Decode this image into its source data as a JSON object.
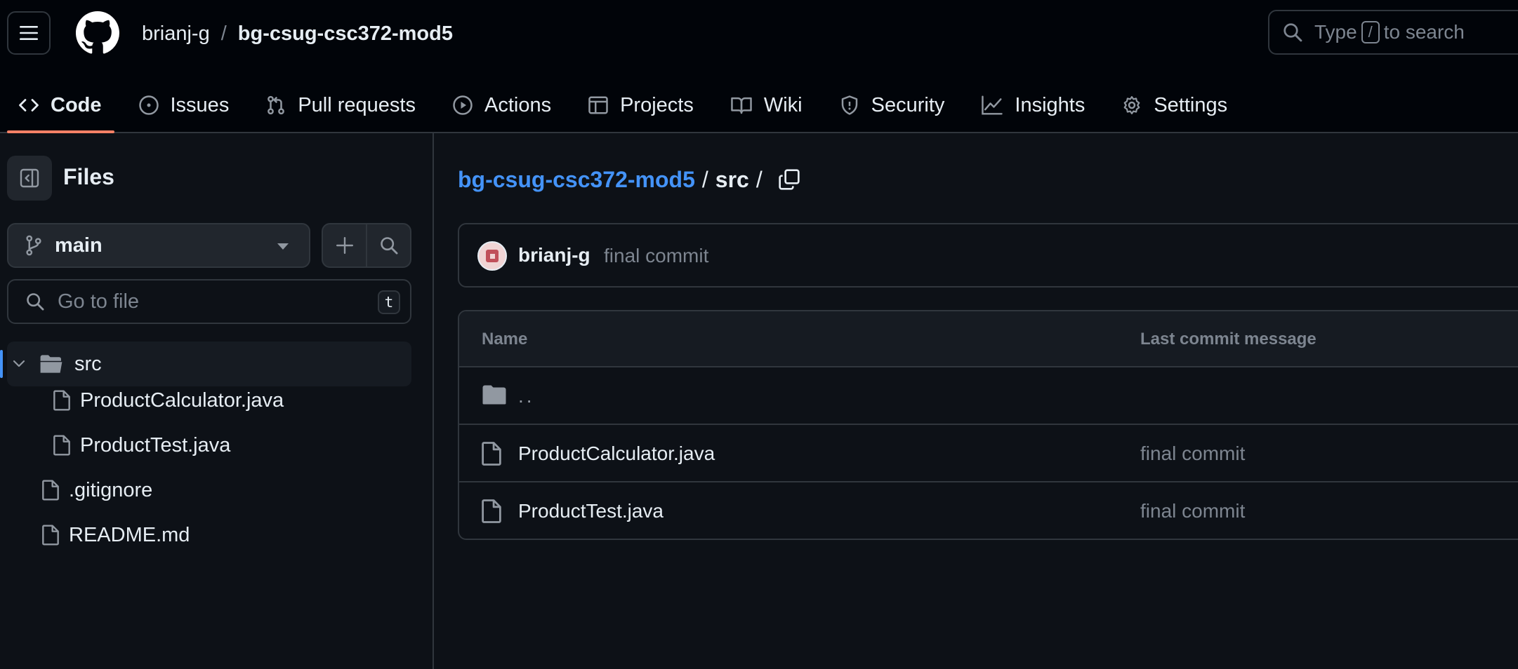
{
  "header": {
    "owner": "brianj-g",
    "separator": "/",
    "repo": "bg-csug-csc372-mod5",
    "search": {
      "prefix": "Type",
      "key": "/",
      "suffix": "to search"
    }
  },
  "nav": {
    "tabs": [
      {
        "label": "Code",
        "icon": "code-icon",
        "active": true
      },
      {
        "label": "Issues",
        "icon": "issue-opened-icon"
      },
      {
        "label": "Pull requests",
        "icon": "git-pull-request-icon"
      },
      {
        "label": "Actions",
        "icon": "play-icon"
      },
      {
        "label": "Projects",
        "icon": "table-icon"
      },
      {
        "label": "Wiki",
        "icon": "book-icon"
      },
      {
        "label": "Security",
        "icon": "shield-icon"
      },
      {
        "label": "Insights",
        "icon": "graph-icon"
      },
      {
        "label": "Settings",
        "icon": "gear-icon"
      }
    ],
    "accent": "#f78166"
  },
  "sidebar": {
    "title": "Files",
    "branch": "main",
    "goto_placeholder": "Go to file",
    "goto_shortcut": "t",
    "tree": [
      {
        "name": "src",
        "type": "folder",
        "expanded": true,
        "selected": true
      },
      {
        "name": "ProductCalculator.java",
        "type": "file",
        "depth": 1
      },
      {
        "name": "ProductTest.java",
        "type": "file",
        "depth": 1
      },
      {
        "name": ".gitignore",
        "type": "file",
        "depth": 0
      },
      {
        "name": "README.md",
        "type": "file",
        "depth": 0
      }
    ]
  },
  "main": {
    "breadcrumb": {
      "repo": "bg-csug-csc372-mod5",
      "sep1": "/",
      "folder": "src",
      "sep2": "/"
    },
    "commit": {
      "author": "brianj-g",
      "message": "final commit"
    },
    "table": {
      "headers": {
        "name": "Name",
        "message": "Last commit message"
      },
      "rows": [
        {
          "name": "..",
          "type": "parent",
          "message": ""
        },
        {
          "name": "ProductCalculator.java",
          "type": "file",
          "message": "final commit"
        },
        {
          "name": "ProductTest.java",
          "type": "file",
          "message": "final commit"
        }
      ]
    }
  },
  "colors": {
    "background": "#0d1117",
    "header_bg": "#010409",
    "link": "#4493f8",
    "border": "#30363d",
    "muted_text": "#7d8590"
  }
}
